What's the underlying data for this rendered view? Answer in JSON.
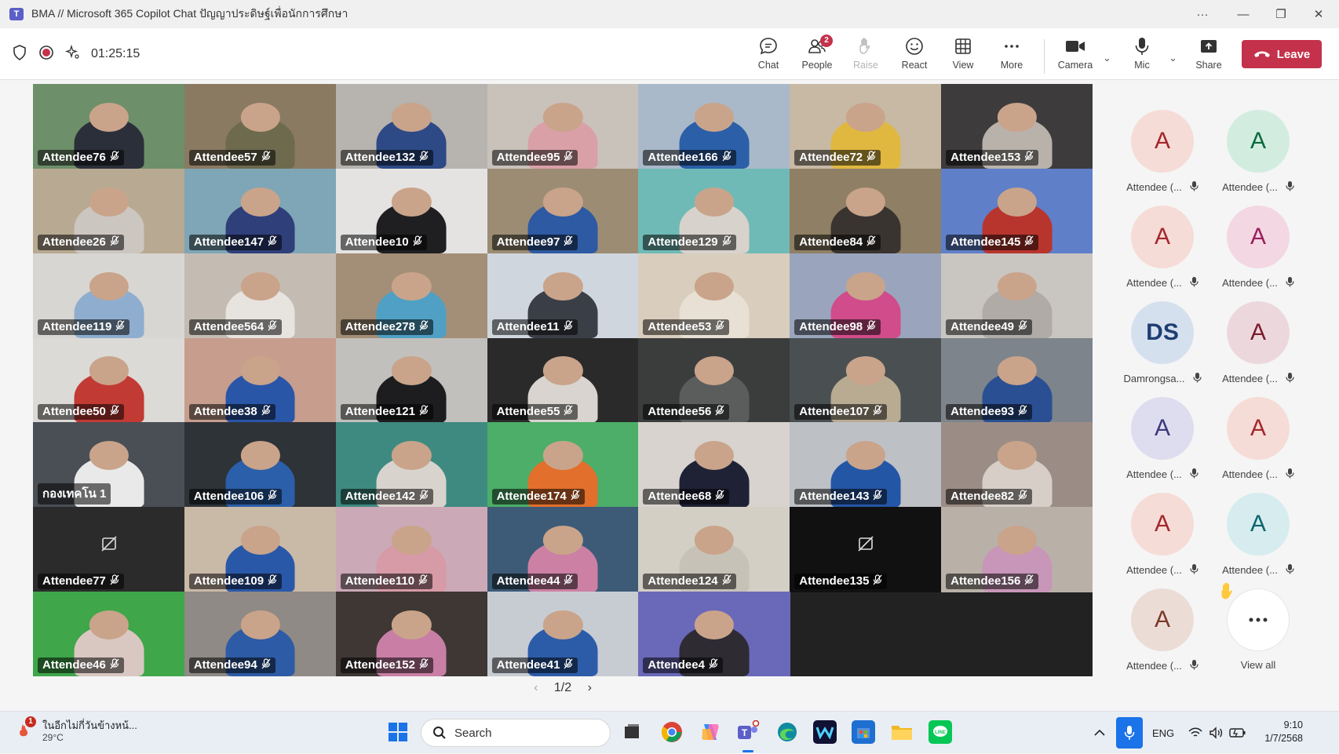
{
  "window": {
    "title": "BMA // Microsoft 365 Copilot Chat ปัญญาประดิษฐ์เพื่อนักการศึกษา",
    "controls": [
      "···",
      "—",
      "❐",
      "✕"
    ]
  },
  "toolbar": {
    "timer": "01:25:15",
    "buttons": [
      {
        "label": "Chat",
        "icon": "chat-icon"
      },
      {
        "label": "People",
        "icon": "people-icon",
        "badge": "2"
      },
      {
        "label": "Raise",
        "icon": "raise-hand-icon",
        "disabled": true
      },
      {
        "label": "React",
        "icon": "react-icon"
      },
      {
        "label": "View",
        "icon": "view-icon"
      },
      {
        "label": "More",
        "icon": "more-icon"
      },
      {
        "label": "Camera",
        "icon": "camera-icon"
      },
      {
        "label": "Mic",
        "icon": "mic-icon"
      },
      {
        "label": "Share",
        "icon": "share-icon"
      }
    ],
    "leave_label": "Leave"
  },
  "gallery": {
    "tiles": [
      {
        "name": "Attendee76",
        "muted": true,
        "bg": "#6d8f6a",
        "person": "#2b2f3a"
      },
      {
        "name": "Attendee57",
        "muted": true,
        "bg": "#8a7a62",
        "person": "#6e6a4e"
      },
      {
        "name": "Attendee132",
        "muted": true,
        "bg": "#b7b3ae",
        "person": "#2d4a86"
      },
      {
        "name": "Attendee95",
        "muted": true,
        "bg": "#c9c2bb",
        "person": "#d9a0a7"
      },
      {
        "name": "Attendee166",
        "muted": true,
        "bg": "#a9b9c9",
        "person": "#2b5fa8"
      },
      {
        "name": "Attendee72",
        "muted": true,
        "bg": "#c7b9a4",
        "person": "#e0b840"
      },
      {
        "name": "Attendee153",
        "muted": true,
        "bg": "#3d3b3c",
        "person": "#b9b2ab"
      },
      {
        "name": "Attendee26",
        "muted": true,
        "bg": "#b8a992",
        "person": "#ccc6c0"
      },
      {
        "name": "Attendee147",
        "muted": true,
        "bg": "#7fa6b6",
        "person": "#2f3f7a"
      },
      {
        "name": "Attendee10",
        "muted": true,
        "bg": "#e5e3e2",
        "person": "#1f1f22"
      },
      {
        "name": "Attendee97",
        "muted": true,
        "bg": "#9c8c74",
        "person": "#2d5aa2"
      },
      {
        "name": "Attendee129",
        "muted": true,
        "bg": "#6fbab6",
        "person": "#d8d2cc"
      },
      {
        "name": "Attendee84",
        "muted": true,
        "bg": "#8f7f64",
        "person": "#3a3430"
      },
      {
        "name": "Attendee145",
        "muted": true,
        "bg": "#5f7fc9",
        "person": "#b8352e"
      },
      {
        "name": "Attendee119",
        "muted": true,
        "bg": "#d8d6d2",
        "person": "#8faecf"
      },
      {
        "name": "Attendee564",
        "muted": true,
        "bg": "#c4bcb3",
        "person": "#e7e3df"
      },
      {
        "name": "Attendee278",
        "muted": true,
        "bg": "#a38f77",
        "person": "#4fa0c4"
      },
      {
        "name": "Attendee11",
        "muted": true,
        "bg": "#cfd6de",
        "person": "#3a3e47"
      },
      {
        "name": "Attendee53",
        "muted": true,
        "bg": "#d9cdbd",
        "person": "#e8e0d4"
      },
      {
        "name": "Attendee98",
        "muted": true,
        "bg": "#9aa5bd",
        "person": "#d14c8a"
      },
      {
        "name": "Attendee49",
        "muted": true,
        "bg": "#c9c6c2",
        "person": "#b0aba6"
      },
      {
        "name": "Attendee50",
        "muted": true,
        "bg": "#dcdad6",
        "person": "#c23a34"
      },
      {
        "name": "Attendee38",
        "muted": true,
        "bg": "#c79d8e",
        "person": "#2a56a8"
      },
      {
        "name": "Attendee121",
        "muted": true,
        "bg": "#c2c0bd",
        "person": "#1d1d1f"
      },
      {
        "name": "Attendee55",
        "muted": true,
        "bg": "#2a2a2a",
        "person": "#d9d4cf"
      },
      {
        "name": "Attendee56",
        "muted": true,
        "bg": "#3b3d3d",
        "person": "#5b5d5d"
      },
      {
        "name": "Attendee107",
        "muted": true,
        "bg": "#4a4f52",
        "person": "#b8ab92"
      },
      {
        "name": "Attendee93",
        "muted": true,
        "bg": "#7e848b",
        "person": "#2a4f93"
      },
      {
        "name": "กองเทคโน 1",
        "muted": false,
        "bg": "#4a4e55",
        "person": "#e9e9e9"
      },
      {
        "name": "Attendee106",
        "muted": true,
        "bg": "#2e3338",
        "person": "#2c5fa9"
      },
      {
        "name": "Attendee142",
        "muted": true,
        "bg": "#3e8a80",
        "person": "#d9d3cd"
      },
      {
        "name": "Attendee174",
        "muted": true,
        "bg": "#4cae68",
        "person": "#e26f2c"
      },
      {
        "name": "Attendee68",
        "muted": true,
        "bg": "#d8d3cf",
        "person": "#1f2235"
      },
      {
        "name": "Attendee143",
        "muted": true,
        "bg": "#bdc0c5",
        "person": "#2456a6"
      },
      {
        "name": "Attendee82",
        "muted": true,
        "bg": "#9b8d86",
        "person": "#d7cfc7"
      },
      {
        "name": "Attendee77",
        "muted": true,
        "bg": "#2b2b2b",
        "person": "",
        "camoff": true
      },
      {
        "name": "Attendee109",
        "muted": true,
        "bg": "#c9b9a7",
        "person": "#2a58a8"
      },
      {
        "name": "Attendee110",
        "muted": true,
        "bg": "#cba9b6",
        "person": "#d79aa7"
      },
      {
        "name": "Attendee44",
        "muted": true,
        "bg": "#3d5b77",
        "person": "#cc80a4"
      },
      {
        "name": "Attendee124",
        "muted": true,
        "bg": "#d4cfc5",
        "person": "#c7c2b8"
      },
      {
        "name": "Attendee135",
        "muted": true,
        "bg": "#111111",
        "person": "",
        "camoff": true
      },
      {
        "name": "Attendee156",
        "muted": true,
        "bg": "#b9b1a7",
        "person": "#c896b8"
      },
      {
        "name": "Attendee46",
        "muted": true,
        "bg": "#3fa64a",
        "person": "#d9c7c2"
      },
      {
        "name": "Attendee94",
        "muted": true,
        "bg": "#8f8a85",
        "person": "#2d5ba5"
      },
      {
        "name": "Attendee152",
        "muted": true,
        "bg": "#3e3734",
        "person": "#c97fa5"
      },
      {
        "name": "Attendee41",
        "muted": true,
        "bg": "#c7ccd3",
        "person": "#2c5ca8"
      },
      {
        "name": "Attendee4",
        "muted": true,
        "bg": "#6a68b8",
        "person": "#2e2b33"
      }
    ],
    "pager": {
      "prev": "‹",
      "label": "1/2",
      "next": "›"
    }
  },
  "roster": {
    "people": [
      {
        "initials": "A",
        "name": "Attendee (...",
        "bg": "#f6dcd6",
        "fg": "#a4262c"
      },
      {
        "initials": "A",
        "name": "Attendee (...",
        "bg": "#d3ece0",
        "fg": "#0b6a3b"
      },
      {
        "initials": "A",
        "name": "Attendee (...",
        "bg": "#f6dcd6",
        "fg": "#a4262c"
      },
      {
        "initials": "A",
        "name": "Attendee (...",
        "bg": "#f3d7e3",
        "fg": "#9b1f5c"
      },
      {
        "initials": "DS",
        "name": "Damrongsa...",
        "bg": "#d5e0ee",
        "fg": "#1e3e72"
      },
      {
        "initials": "A",
        "name": "Attendee (...",
        "bg": "#ecd8dc",
        "fg": "#7a1b2c"
      },
      {
        "initials": "A",
        "name": "Attendee (...",
        "bg": "#dedcef",
        "fg": "#3b3a7a"
      },
      {
        "initials": "A",
        "name": "Attendee (...",
        "bg": "#f6dcd6",
        "fg": "#a4262c"
      },
      {
        "initials": "A",
        "name": "Attendee (...",
        "bg": "#f6dcd6",
        "fg": "#a4262c"
      },
      {
        "initials": "A",
        "name": "Attendee (...",
        "bg": "#d6ecee",
        "fg": "#0e6470"
      },
      {
        "initials": "A",
        "name": "Attendee (...",
        "bg": "#ecdcd6",
        "fg": "#7a3a28"
      }
    ],
    "view_all_label": "View all"
  },
  "taskbar": {
    "weather": {
      "badge": "1",
      "text": "ในอีกไม่กี่วันข้างหน้...",
      "temp": "29°C"
    },
    "search_placeholder": "Search",
    "apps": [
      {
        "icon": "windows-start-icon",
        "color": "#1a73e8"
      },
      {
        "icon": "task-view-icon",
        "color": "#333333"
      },
      {
        "icon": "chrome-icon",
        "color": "#db4437"
      },
      {
        "icon": "copilot-icon",
        "color": "#7b61ff"
      },
      {
        "icon": "teams-icon",
        "color": "#5b5fc7"
      },
      {
        "icon": "edge-icon",
        "color": "#0f8a9e"
      },
      {
        "icon": "webex-icon",
        "color": "#111133"
      },
      {
        "icon": "store-icon",
        "color": "#1f6fd1"
      },
      {
        "icon": "file-explorer-icon",
        "color": "#f2b824"
      },
      {
        "icon": "line-icon",
        "color": "#06c755"
      }
    ],
    "lang": "ENG",
    "time": "9:10",
    "date": "1/7/2568"
  }
}
